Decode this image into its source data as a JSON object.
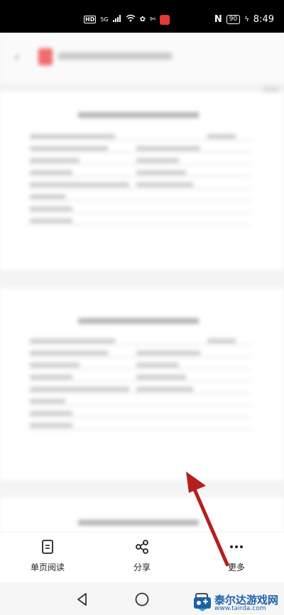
{
  "status_bar": {
    "indicators": [
      "HD",
      "5G",
      "signal-icon",
      "wifi-icon",
      "app-icon",
      "app-icon",
      "app-icon"
    ],
    "nfc_icon": "nfc-icon",
    "battery": "90",
    "time": "8:49"
  },
  "toolbar": {
    "single_page": {
      "label": "单页阅读",
      "icon": "document-page-icon"
    },
    "share": {
      "label": "分享",
      "icon": "share-icon"
    },
    "more": {
      "label": "更多",
      "icon": "more-dots-icon"
    }
  },
  "nav": {
    "back": "triangle-back-icon",
    "home": "circle-home-icon",
    "recents": "square-recents-icon"
  },
  "annotation": {
    "arrow_color": "#b3201d",
    "points_to": "more"
  },
  "watermark": {
    "name_cn": "泰尔达游戏网",
    "url": "www.tairda.com"
  }
}
